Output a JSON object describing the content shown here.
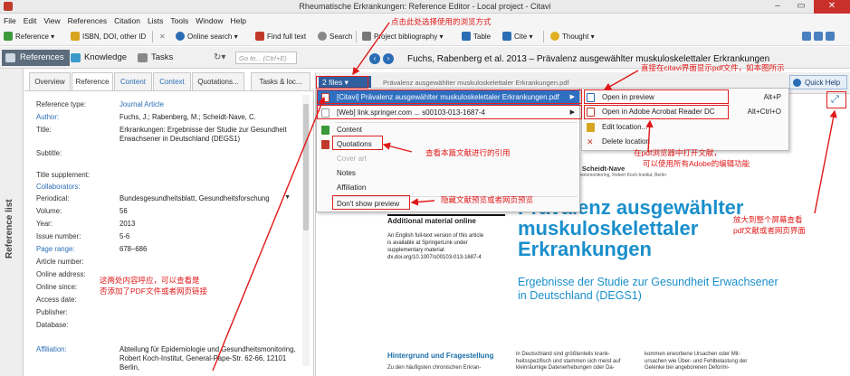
{
  "window": {
    "title": "Rheumatische Erkrankungen: Reference Editor - Local project - Citavi",
    "minimize": "–",
    "maximize": "▭",
    "close": "✕"
  },
  "menu": [
    "File",
    "Edit",
    "View",
    "References",
    "Citation",
    "Lists",
    "Tools",
    "Window",
    "Help"
  ],
  "toolbar": {
    "reference": "Reference ▾",
    "isbn": "ISBN, DOI, other ID",
    "online_search": "Online search ▾",
    "find_full_text": "Find full text",
    "search": "Search",
    "project_bibliography": "Project bibliography ▾",
    "table": "Table",
    "cite": "Cite ▾",
    "thought": "Thought ▾"
  },
  "nav": {
    "references": "References",
    "knowledge": "Knowledge",
    "tasks": "Tasks",
    "goto_placeholder": "Go to... (Ctrl+E)"
  },
  "sidebar_label": "Reference list",
  "editor_tabs": [
    "Overview",
    "Reference",
    "Content",
    "Context",
    "Quotations...",
    "Tasks & loc..."
  ],
  "fields": [
    {
      "label": "Reference type:",
      "value": "Journal Article",
      "label_link": false,
      "value_link": true
    },
    {
      "label": "Author:",
      "value": "Fuchs, J.; Rabenberg, M.; Scheidt-Nave, C.",
      "label_link": true,
      "value_link": false
    },
    {
      "label": "Title:",
      "value": "Erkrankungen: Ergebnisse der Studie zur Gesundheit Erwachsener in Deutschland (DEGS1)",
      "label_link": false,
      "value_link": false
    },
    {
      "label": "Subtitle:",
      "value": "",
      "label_link": false,
      "value_link": false
    },
    {
      "label": "Title supplement:",
      "value": "",
      "label_link": false,
      "value_link": false
    },
    {
      "label": "Collaborators:",
      "value": "",
      "label_link": true,
      "value_link": false
    },
    {
      "label": "Periodical:",
      "value": "Bundesgesundheitsblatt, Gesundheitsforschung",
      "label_link": false,
      "value_link": false
    },
    {
      "label": "Volume:",
      "value": "56",
      "label_link": false,
      "value_link": false
    },
    {
      "label": "Year:",
      "value": "2013",
      "label_link": false,
      "value_link": false
    },
    {
      "label": "Issue number:",
      "value": "5-6",
      "label_link": false,
      "value_link": false
    },
    {
      "label": "Page range:",
      "value": "678–686",
      "label_link": true,
      "value_link": false
    },
    {
      "label": "Article number:",
      "value": "",
      "label_link": false,
      "value_link": false
    },
    {
      "label": "Online address:",
      "value": "",
      "label_link": false,
      "value_link": false
    },
    {
      "label": "Online since:",
      "value": "",
      "label_link": false,
      "value_link": false
    },
    {
      "label": "Access date:",
      "value": "",
      "label_link": false,
      "value_link": false
    },
    {
      "label": "Publisher:",
      "value": "",
      "label_link": false,
      "value_link": false
    },
    {
      "label": "Database:",
      "value": "",
      "label_link": false,
      "value_link": false
    },
    {
      "label": "Affiliation:",
      "value": "Abteilung für Epidemiologie und Gesundheitsmonitoring, Robert Koch-Institut, General-Pape-Str. 62-66, 12101 Berlin,",
      "label_link": true,
      "value_link": false
    }
  ],
  "pane": {
    "files_button": "2 files ▾",
    "pdf_name": "Prävalenz ausgewählter muskuloskelettaler Erkrankungen.pdf",
    "citation_title": "Fuchs, Rabenberg et al. 2013 – Prävalenz ausgewählter muskuloskelettaler Erkrankungen",
    "quick_help": "Quick Help"
  },
  "files_menu": {
    "file1": "[Citavi] Prävalenz ausgewählter muskuloskelettaler Erkrankungen.pdf",
    "file2": "[Web] link.springer.com ... s00103-013-1687-4",
    "content": "Content",
    "quotations": "Quotations",
    "cover_art": "Cover art",
    "notes": "Notes",
    "affiliation": "Affiliation",
    "dont_show": "Don't show preview"
  },
  "open_menu": {
    "open_preview": "Open in preview",
    "open_preview_sc": "Alt+P",
    "open_acrobat": "Open in Adobe Acrobat Reader DC",
    "open_acrobat_sc": "Alt+Ctrl+O",
    "edit_location": "Edit location...",
    "delete_location": "Delete location"
  },
  "pdf": {
    "authors": "g · C. Scheidt-Nave",
    "affil": "Gesundheitsmonitoring, Robert Koch-Institut, Berlin",
    "title_line1": "Prävalenz ausgewählter",
    "title_line2": "muskuloskelettaler",
    "title_line3": "Erkrankungen",
    "subtitle": "Ergebnisse der Studie zur Gesundheit Erwachsener in Deutschland (DEGS1)",
    "box_title": "Additional material online",
    "box_text": "An English full-text version of this article is available at SpringerLink under supplementary material: dx.doi.org/10.1007/s00103-013-1687-4",
    "section_head": "Hintergrund und Fragestellung",
    "col1": "Zu den häufigsten chronischen Erkran-",
    "col2": "in Deutschland sind größtenteils krank-heitsspezifisch und stammen sich meist auf kleinräumige Datenerhebungen oder Da-",
    "col3": "kommen erworbene Ursachen oder Mit-ursachen wie Über- und Fehlbelastung der Gelenke bei angeborenen Deformi-"
  },
  "annotations": {
    "a1": "点击此处选择使用的浏览方式",
    "a2": "直接在citavi界面显示pdf文件，如本图所示",
    "a3": "在pdf浏览器中打开文献，",
    "a3b": "可以使用所有Adobe的编辑功能",
    "a4": "查看本篇文献进行的引用",
    "a5": "隐藏文献预览或者网页预览",
    "a6": "放大到整个屏幕查看",
    "a6b": "pdf文献或者网页界面",
    "a7": "这两处内容呼应，可以查看是",
    "a7b": "否添加了PDF文件或者网页链接"
  },
  "colors": {
    "annotation_red": "#e01818",
    "highlight_blue": "#2f6fc0",
    "pdf_title_blue": "#1a8fcc"
  }
}
